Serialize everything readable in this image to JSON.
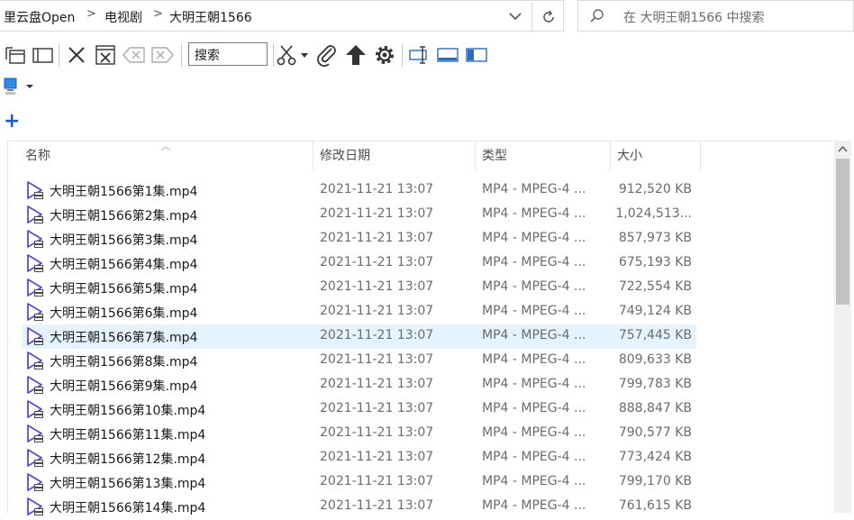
{
  "breadcrumb": {
    "items": [
      "里云盘Open",
      "电视剧",
      "大明王朝1566"
    ],
    "separator": ">"
  },
  "search": {
    "placeholder": "在 大明王朝1566 中搜索"
  },
  "toolbar": {
    "search_label": "搜索"
  },
  "columns": [
    "名称",
    "修改日期",
    "类型",
    "大小"
  ],
  "files": [
    {
      "name": "大明王朝1566第1集.mp4",
      "date": "2021-11-21 13:07",
      "type": "MP4 - MPEG-4 ...",
      "size": "912,520 KB"
    },
    {
      "name": "大明王朝1566第2集.mp4",
      "date": "2021-11-21 13:07",
      "type": "MP4 - MPEG-4 ...",
      "size": "1,024,513..."
    },
    {
      "name": "大明王朝1566第3集.mp4",
      "date": "2021-11-21 13:07",
      "type": "MP4 - MPEG-4 ...",
      "size": "857,973 KB"
    },
    {
      "name": "大明王朝1566第4集.mp4",
      "date": "2021-11-21 13:07",
      "type": "MP4 - MPEG-4 ...",
      "size": "675,193 KB"
    },
    {
      "name": "大明王朝1566第5集.mp4",
      "date": "2021-11-21 13:07",
      "type": "MP4 - MPEG-4 ...",
      "size": "722,554 KB"
    },
    {
      "name": "大明王朝1566第6集.mp4",
      "date": "2021-11-21 13:07",
      "type": "MP4 - MPEG-4 ...",
      "size": "749,124 KB"
    },
    {
      "name": "大明王朝1566第7集.mp4",
      "date": "2021-11-21 13:07",
      "type": "MP4 - MPEG-4 ...",
      "size": "757,445 KB"
    },
    {
      "name": "大明王朝1566第8集.mp4",
      "date": "2021-11-21 13:07",
      "type": "MP4 - MPEG-4 ...",
      "size": "809,633 KB"
    },
    {
      "name": "大明王朝1566第9集.mp4",
      "date": "2021-11-21 13:07",
      "type": "MP4 - MPEG-4 ...",
      "size": "799,783 KB"
    },
    {
      "name": "大明王朝1566第10集.mp4",
      "date": "2021-11-21 13:07",
      "type": "MP4 - MPEG-4 ...",
      "size": "888,847 KB"
    },
    {
      "name": "大明王朝1566第11集.mp4",
      "date": "2021-11-21 13:07",
      "type": "MP4 - MPEG-4 ...",
      "size": "790,577 KB"
    },
    {
      "name": "大明王朝1566第12集.mp4",
      "date": "2021-11-21 13:07",
      "type": "MP4 - MPEG-4 ...",
      "size": "773,424 KB"
    },
    {
      "name": "大明王朝1566第13集.mp4",
      "date": "2021-11-21 13:07",
      "type": "MP4 - MPEG-4 ...",
      "size": "799,170 KB"
    },
    {
      "name": "大明王朝1566第14集.mp4",
      "date": "2021-11-21 13:07",
      "type": "MP4 - MPEG-4 ...",
      "size": "761,615 KB"
    }
  ],
  "selected_row": 6,
  "colors": {
    "selection": "#e5f3ff",
    "accent_blue": "#1b5fc1",
    "icon_purple": "#5b4bc4",
    "text_secondary": "#6b6b6b"
  }
}
